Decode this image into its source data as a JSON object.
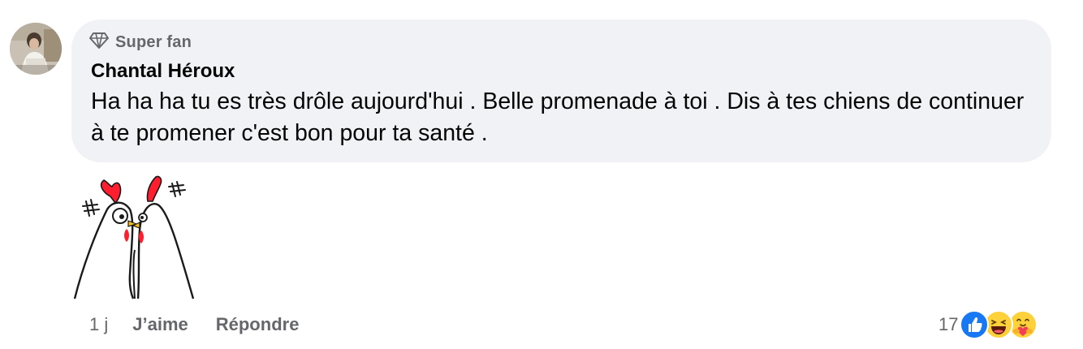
{
  "comment": {
    "badge": "Super fan",
    "author": "Chantal Héroux",
    "text": "Ha ha ha tu es très drôle aujourd'hui . Belle promenade à toi . Dis à tes chiens de continuer à te promener c'est bon pour ta santé .",
    "sticker_icon": "two-chickens-sticker"
  },
  "actions": {
    "time": "1 j",
    "like_label": "J’aime",
    "reply_label": "Répondre"
  },
  "reactions": {
    "count": "17",
    "icons": [
      "like-reaction-icon",
      "haha-reaction-icon",
      "care-reaction-icon"
    ]
  },
  "colors": {
    "bubble_bg": "#f0f2f5",
    "secondary_text": "#65676b",
    "like_blue": "#1877f2",
    "emoji_yellow": "#fdd13a"
  }
}
